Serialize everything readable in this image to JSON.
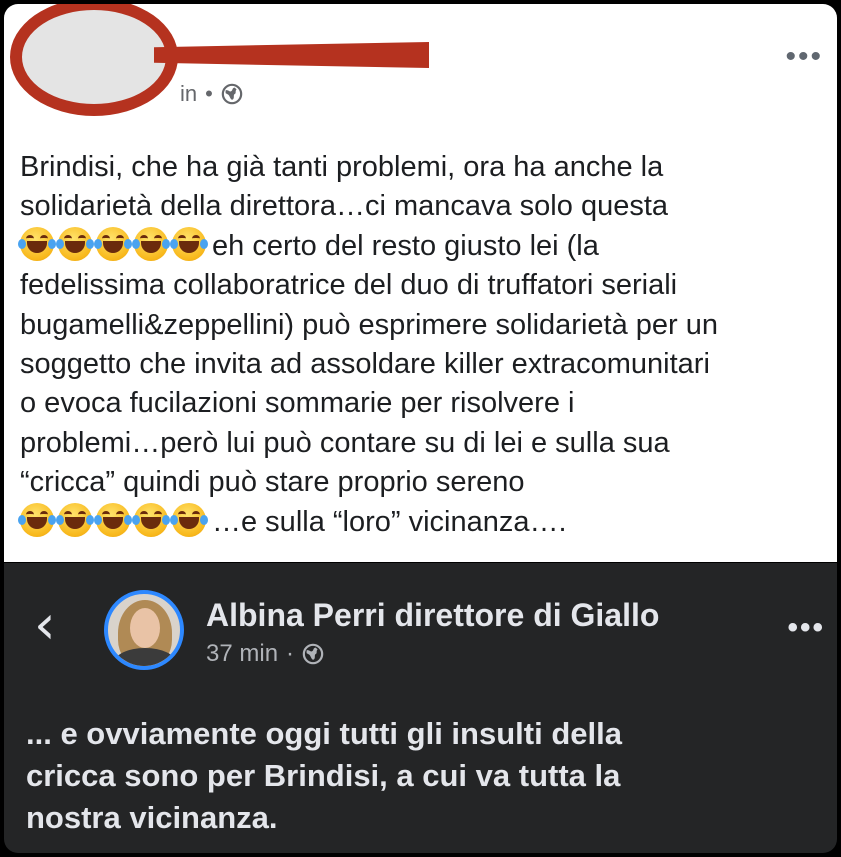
{
  "post": {
    "time_fragment": "in",
    "separator": "•",
    "more_label": "•••",
    "text_lines": [
      "Brindisi, che ha già tanti problemi, ora ha anche la",
      "solidarietà della direttora…ci mancava solo questa",
      "eh certo del resto giusto lei (la",
      "fedelissima collaboratrice del duo di truffatori seriali",
      "bugamelli&zeppellini) può esprimere solidarietà per un",
      "soggetto che invita ad assoldare killer extracomunitari",
      "o evoca fucilazioni sommarie per risolvere i",
      "problemi…però lui può contare su di lei e sulla sua",
      "“cricca” quindi può stare proprio sereno",
      "…e sulla “loro” vicinanza…."
    ],
    "emoji_name": "face-with-tears-of-joy-icon",
    "emoji_count": 5
  },
  "shared_post": {
    "back_glyph": "‹",
    "author": "Albina Perri direttore di Giallo",
    "time": "37 min",
    "separator": "·",
    "more_label": "•••",
    "text_lines": [
      "... e ovviamente oggi tutti gli insulti della",
      "cricca sono per Brindisi, a cui va tutta la",
      "nostra vicinanza."
    ]
  },
  "colors": {
    "redaction": "#b5321f",
    "dark_card": "#242526",
    "avatar_ring": "#2d88ff"
  }
}
